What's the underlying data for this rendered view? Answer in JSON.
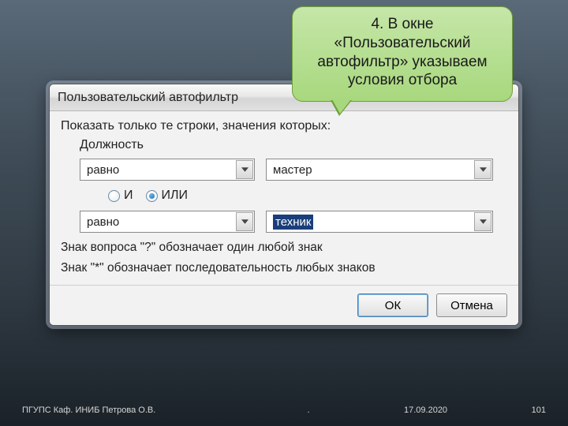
{
  "callout": {
    "text": "4. В окне «Пользовательский автофильтр» указываем условия отбора"
  },
  "dialog": {
    "title": "Пользовательский автофильтр",
    "instruction": "Показать только те строки, значения которых:",
    "column_label": "Должность",
    "row1": {
      "operator": "равно",
      "value": "мастер"
    },
    "logic": {
      "and_label": "И",
      "or_label": "ИЛИ",
      "selected": "or"
    },
    "row2": {
      "operator": "равно",
      "value": "техник"
    },
    "hint1": "Знак вопроса \"?\" обозначает один любой знак",
    "hint2": "Знак \"*\" обозначает последовательность любых знаков",
    "ok_label": "ОК",
    "cancel_label": "Отмена"
  },
  "slide": {
    "author": "ПГУПС  Каф. ИНИБ   Петрова О.В.",
    "mid": ".",
    "date": "17.09.2020",
    "page": "101"
  }
}
